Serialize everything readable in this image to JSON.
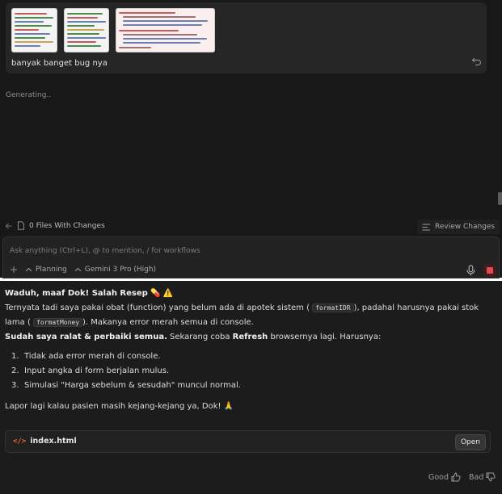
{
  "message": {
    "text": "banyak banget bug nya",
    "attachments": [
      "screenshot-1",
      "screenshot-2",
      "screenshot-3"
    ]
  },
  "status": "Generating..",
  "files_bar": {
    "files_label": "0 Files With Changes",
    "review_label": "Review Changes"
  },
  "input": {
    "placeholder": "Ask anything (Ctrl+L), @ to mention, / for workflows",
    "mode_label": "Planning",
    "model_label": "Gemini 3 Pro (High)"
  },
  "reply": {
    "heading": "Waduh, maaf Dok! Salah Resep",
    "heading_emojis": "💊 ⚠️",
    "para1_start": "Ternyata tadi saya pakai obat (function) yang belum ada di apotek sistem (",
    "code1": "formatIDR",
    "para1_mid": "), padahal harusnya pakai stok lama (",
    "code2": "formatMoney",
    "para1_end": "). Makanya error merah semua di console.",
    "para2_bold": "Sudah saya ralat & perbaiki semua.",
    "para2_mid": " Sekarang coba ",
    "para2_refresh": "Refresh",
    "para2_end": " browsernya lagi. Harusnya:",
    "items": [
      "Tidak ada error merah di console.",
      "Input angka di form berjalan mulus.",
      "Simulasi \"Harga sebelum & sesudah\" muncul normal."
    ],
    "closing": "Lapor lagi kalau pasien masih kejang-kejang ya, Dok! 🙏"
  },
  "file_card": {
    "icon": "code-icon",
    "name": "index.html",
    "open_label": "Open"
  },
  "feedback": {
    "good_label": "Good",
    "bad_label": "Bad"
  },
  "colors": {
    "panel_bg": "#181818",
    "card_bg": "#262626",
    "reply_bg": "#1c1c1c",
    "code_icon": "#e86b3a",
    "stop_red": "#e5484d"
  }
}
